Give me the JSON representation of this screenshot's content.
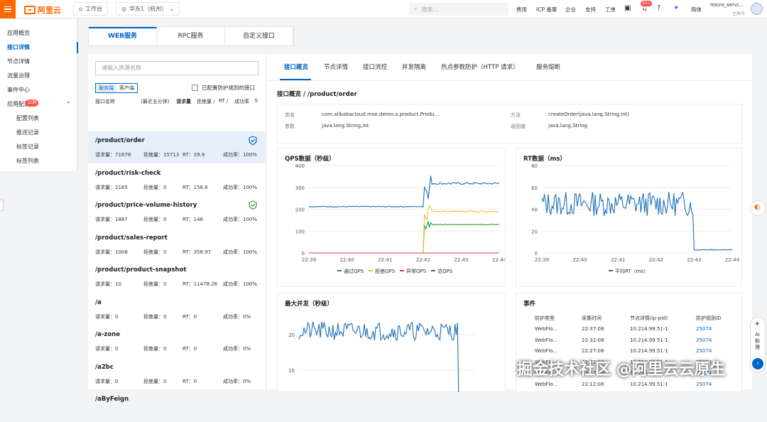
{
  "topbar": {
    "logo": "阿里云",
    "workbench": "工作台",
    "region": "华东1（杭州）",
    "search_placeholder": "搜索...",
    "nav": [
      "费用",
      "ICP 备案",
      "企业",
      "支持",
      "工单"
    ],
    "badge": "99+",
    "lang": "简体",
    "account": "micro_servi...",
    "account_sub": "主账号"
  },
  "sidebar": {
    "items": [
      {
        "label": "应用概览"
      },
      {
        "label": "接口详情",
        "active": true
      },
      {
        "label": "节点详情"
      },
      {
        "label": "流量治理"
      },
      {
        "label": "事件中心"
      },
      {
        "label": "应用配置",
        "badge": "公测"
      },
      {
        "label": "配置列表",
        "sub": true
      },
      {
        "label": "推送记录",
        "sub": true
      },
      {
        "label": "标签记录",
        "sub": true
      },
      {
        "label": "标签列表",
        "sub": true
      }
    ]
  },
  "main_tabs": [
    "WEB服务",
    "RPC服务",
    "自定义接口"
  ],
  "resource_list": {
    "search_placeholder": "请输入资源名称",
    "segments": [
      "服务端",
      "客户端"
    ],
    "checkbox_label": "已配置防护规则的接口",
    "headers": {
      "name": "接口名称",
      "period": "(最近五分钟)",
      "req": "请求量",
      "rej": "拒绝量 /",
      "rt": "RT /",
      "ok": "成功率"
    },
    "items": [
      {
        "name": "/product/order",
        "req": "请求量：71678",
        "rej": "拒绝量：15713",
        "rt": "RT：29.9",
        "ok": "成功率：100%",
        "shield": "blue",
        "selected": true
      },
      {
        "name": "/product/risk-check",
        "req": "请求量：2165",
        "rej": "拒绝量：0",
        "rt": "RT：158.6",
        "ok": "成功率：100%"
      },
      {
        "name": "/product/price-volume-history",
        "req": "请求量：1887",
        "rej": "拒绝量：0",
        "rt": "RT：146",
        "ok": "成功率：100%",
        "shield": "green"
      },
      {
        "name": "/product/sales-report",
        "req": "请求量：1008",
        "rej": "拒绝量：0",
        "rt": "RT：358.97",
        "ok": "成功率：100%"
      },
      {
        "name": "/product/product-snapshot",
        "req": "请求量：10",
        "rej": "拒绝量：0",
        "rt": "RT：11478.26",
        "ok": "成功率：100%"
      },
      {
        "name": "/a",
        "req": "请求量：0",
        "rej": "拒绝量：0",
        "rt": "RT：0",
        "ok": "成功率：0%"
      },
      {
        "name": "/a-zone",
        "req": "请求量：0",
        "rej": "拒绝量：0",
        "rt": "RT：0",
        "ok": "成功率：0%"
      },
      {
        "name": "/a2bc",
        "req": "请求量：0",
        "rej": "拒绝量：0",
        "rt": "RT：0",
        "ok": "成功率：0%"
      },
      {
        "name": "/aByFeign",
        "req": "",
        "rej": "",
        "rt": "",
        "ok": ""
      }
    ]
  },
  "detail": {
    "subtabs": [
      "接口概览",
      "节点详情",
      "接口流控",
      "并发隔离",
      "热点参数防护（HTTP 请求）",
      "服务熔断"
    ],
    "title": "接口概览 / /product/order",
    "info": {
      "class_k": "类名",
      "class_v": "com.alibabacloud.mse.demo.a.product.Produ...",
      "param_k": "参数",
      "param_v": "java.lang.String,int",
      "method_k": "方法",
      "method_v": "createOrder(java.lang.String,int)",
      "ret_k": "返回值",
      "ret_v": "java.lang.String"
    },
    "qps_title": "QPS数据（秒级）",
    "rt_title": "RT数据（ms）",
    "conc_title": "最大并发（秒级）",
    "events_title": "事件",
    "events_headers": [
      "防护类型",
      "采集时间",
      "节点详情(ip-pid)",
      "防护规则ID"
    ],
    "events": [
      [
        "WebFlo...",
        "22:37:08",
        "10.214.99.51-1",
        "25074"
      ],
      [
        "WebFlo...",
        "22:32:08",
        "10.214.99.51-1",
        "25074"
      ],
      [
        "WebFlo...",
        "22:27:08",
        "10.214.99.51-1",
        "25074"
      ],
      [
        "WebFlo...",
        "22:22:08",
        "10.214.99.51-1",
        "25074"
      ],
      [
        "WebFlo...",
        "22:17:08",
        "10.214.99.51-1",
        "25074"
      ],
      [
        "WebFlo...",
        "22:12:08",
        "10.214.99.51-1",
        "25074"
      ]
    ]
  },
  "floating": {
    "ai_label": "AI助理"
  },
  "watermark": "掘金技术社区 @阿里云云原生",
  "chart_data": [
    {
      "type": "line",
      "title": "QPS数据（秒级）",
      "x": [
        "22:39",
        "22:40",
        "22:41",
        "22:42",
        "22:43",
        "22:44"
      ],
      "ylim": [
        0,
        400
      ],
      "yticks": [
        0,
        100,
        200,
        300,
        400
      ],
      "series": [
        {
          "name": "通过QPS",
          "color": "#2a9d3a",
          "before": 0,
          "after": 130
        },
        {
          "name": "拒绝QPS",
          "color": "#e6c229",
          "before": 0,
          "after": 190
        },
        {
          "name": "异常QPS",
          "color": "#d9363e",
          "before": 0,
          "after": 0
        },
        {
          "name": "总QPS",
          "color": "#1f6fb5",
          "before": 212,
          "after": 318
        }
      ],
      "change_at": "22:42"
    },
    {
      "type": "line",
      "title": "RT数据（ms）",
      "x": [
        "22:39",
        "22:40",
        "22:41",
        "22:42",
        "22:43",
        "22:44"
      ],
      "ylim": [
        0,
        80
      ],
      "yticks": [
        0,
        20,
        40,
        60,
        80
      ],
      "series": [
        {
          "name": "平均RT（ms）",
          "color": "#1f6fb5",
          "before": 45,
          "after": 3
        }
      ],
      "change_at": "22:43"
    },
    {
      "type": "line",
      "title": "最大并发（秒级）",
      "ylim": [
        0,
        30
      ],
      "yticks": [
        10,
        20,
        30
      ],
      "series": [
        {
          "name": "最大并发",
          "color": "#1f6fb5",
          "before": 21,
          "after": 0
        }
      ]
    }
  ]
}
